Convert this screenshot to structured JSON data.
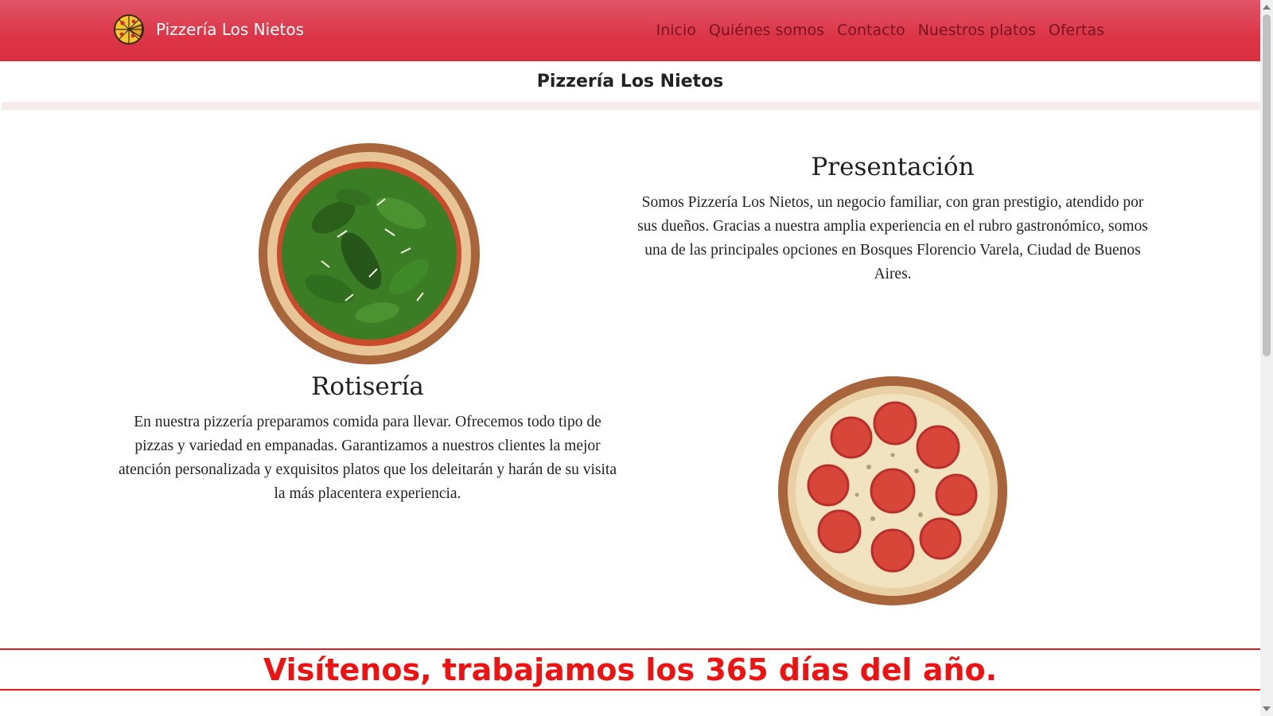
{
  "navbar": {
    "brand_name": "Pizzería Los Nietos",
    "brand_icon": "pizza-icon",
    "links": [
      "Inicio",
      "Quiénes somos",
      "Contacto",
      "Nuestros platos",
      "Ofertas"
    ],
    "background": "#dc3547"
  },
  "subheader": {
    "title": "Pizzería Los Nietos"
  },
  "presentacion": {
    "title": "Presentación",
    "body": "Somos Pizzería Los Nietos, un negocio familiar, con gran prestigio, atendido por sus dueños. Gracias a nuestra amplia experiencia en el rubro gastronómico, somos una de las principales opciones en Bosques Florencio Varela, Ciudad de Buenos Aires."
  },
  "rotiseria": {
    "title": "Rotisería",
    "body": "En nuestra pizzería preparamos comida para llevar. Ofrecemos todo tipo de pizzas y variedad en empanadas. Garantizamos a nuestros clientes la mejor atención personalizada y exquisitos platos que los deleitarán y harán de su visita la más placentera experiencia."
  },
  "banner": {
    "text": "Visítenos, trabajamos los 365 días del año.",
    "color": "#ee1313"
  },
  "images": {
    "pizza_1": "arugula-pizza-image",
    "pizza_2": "tomato-pizza-image"
  }
}
